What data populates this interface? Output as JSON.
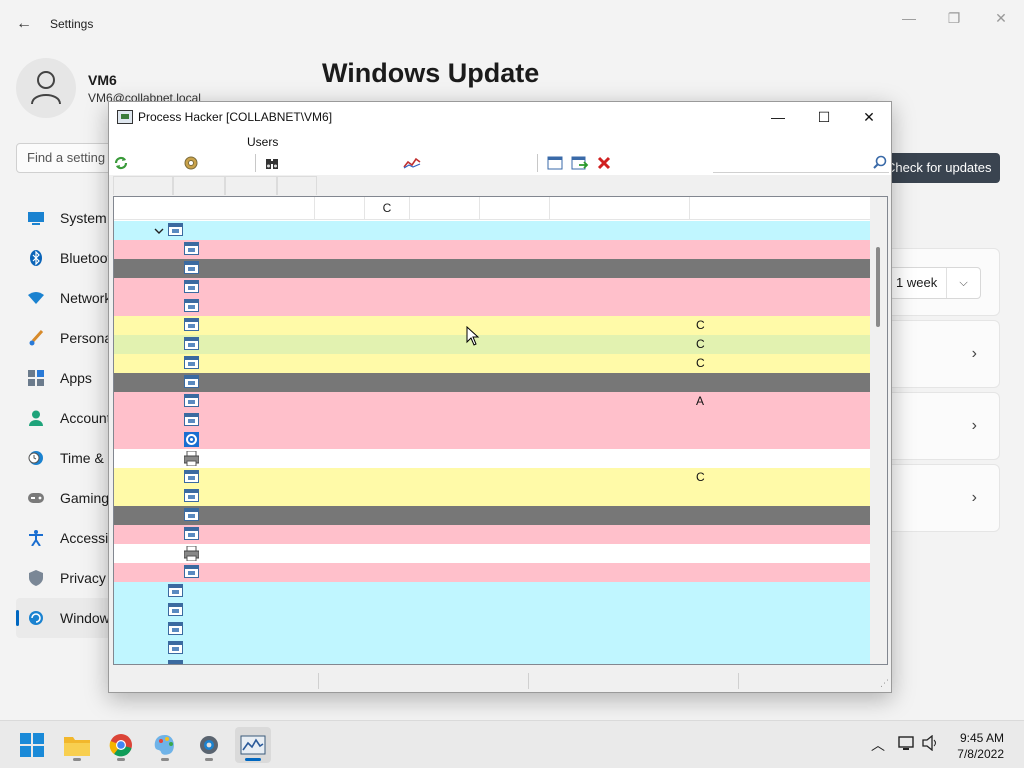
{
  "settings": {
    "title": "Settings",
    "user": {
      "name": "VM6",
      "email": "VM6@collabnet.local"
    },
    "search_placeholder": "Find a setting",
    "nav": [
      {
        "label": "System",
        "icon": "monitor-icon"
      },
      {
        "label": "Bluetooth & devices",
        "icon": "bluetooth-icon"
      },
      {
        "label": "Network & internet",
        "icon": "wifi-icon"
      },
      {
        "label": "Personalization",
        "icon": "brush-icon"
      },
      {
        "label": "Apps",
        "icon": "apps-icon"
      },
      {
        "label": "Accounts",
        "icon": "person-icon"
      },
      {
        "label": "Time & language",
        "icon": "clock-globe-icon"
      },
      {
        "label": "Gaming",
        "icon": "gamepad-icon"
      },
      {
        "label": "Accessibility",
        "icon": "accessibility-icon"
      },
      {
        "label": "Privacy & security",
        "icon": "shield-icon"
      },
      {
        "label": "Windows Update",
        "icon": "update-icon",
        "active": true
      }
    ],
    "page_title": "Windows Update",
    "check_button": "Check for updates",
    "pause_value": "1 week"
  },
  "process_hacker": {
    "title": "Process Hacker [COLLABNET\\VM6]",
    "menu": {
      "users": "Users"
    },
    "header_c": "C",
    "rows": [
      {
        "color": "#c0f6ff",
        "indent": 1,
        "icon": "process",
        "expanded": true,
        "c": ""
      },
      {
        "color": "#ffc0cb",
        "indent": 2,
        "icon": "process",
        "c": ""
      },
      {
        "color": "#777777",
        "indent": 2,
        "icon": "process",
        "c": ""
      },
      {
        "color": "#ffc0cb",
        "indent": 2,
        "icon": "process",
        "c": ""
      },
      {
        "color": "#ffc0cb",
        "indent": 2,
        "icon": "process",
        "c": ""
      },
      {
        "color": "#fffaa8",
        "indent": 2,
        "icon": "process",
        "c": "C"
      },
      {
        "color": "#e2f2b0",
        "indent": 2,
        "icon": "process",
        "c": "C"
      },
      {
        "color": "#fffaa8",
        "indent": 2,
        "icon": "process",
        "c": "C"
      },
      {
        "color": "#777777",
        "indent": 2,
        "icon": "process",
        "c": ""
      },
      {
        "color": "#ffc0cb",
        "indent": 2,
        "icon": "process",
        "c": "A"
      },
      {
        "color": "#ffc0cb",
        "indent": 2,
        "icon": "process",
        "c": ""
      },
      {
        "color": "#ffc0cb",
        "indent": 2,
        "icon": "gear",
        "c": ""
      },
      {
        "color": "#ffffff",
        "indent": 2,
        "icon": "printer",
        "c": ""
      },
      {
        "color": "#fffaa8",
        "indent": 2,
        "icon": "process",
        "c": "C"
      },
      {
        "color": "#fffaa8",
        "indent": 2,
        "icon": "process",
        "c": ""
      },
      {
        "color": "#777777",
        "indent": 2,
        "icon": "process",
        "c": ""
      },
      {
        "color": "#ffc0cb",
        "indent": 2,
        "icon": "process",
        "c": ""
      },
      {
        "color": "#ffffff",
        "indent": 2,
        "icon": "printer",
        "c": ""
      },
      {
        "color": "#ffc0cb",
        "indent": 2,
        "icon": "process",
        "c": ""
      },
      {
        "color": "#c0f6ff",
        "indent": 1,
        "icon": "process",
        "c": ""
      },
      {
        "color": "#c0f6ff",
        "indent": 1,
        "icon": "process",
        "c": ""
      },
      {
        "color": "#c0f6ff",
        "indent": 1,
        "icon": "process",
        "c": ""
      },
      {
        "color": "#c0f6ff",
        "indent": 1,
        "icon": "process",
        "c": ""
      },
      {
        "color": "#c0f6ff",
        "indent": 1,
        "icon": "process",
        "c": ""
      }
    ]
  },
  "taskbar": {
    "apps": [
      {
        "name": "start-button",
        "icon": "windows-logo-icon"
      },
      {
        "name": "file-explorer",
        "icon": "folder-icon"
      },
      {
        "name": "chrome",
        "icon": "chrome-icon"
      },
      {
        "name": "paint",
        "icon": "paint-icon"
      },
      {
        "name": "settings",
        "icon": "gear-icon"
      },
      {
        "name": "process-hacker",
        "icon": "process-hacker-icon",
        "active": true
      }
    ],
    "time": "9:45 AM",
    "date": "7/8/2022"
  },
  "colors": {
    "accent": "#0067c0",
    "row_pink": "#ffc0cb",
    "row_gray": "#777777",
    "row_yellow": "#fffaa8",
    "row_cyan": "#c0f6ff",
    "row_green": "#e2f2b0"
  }
}
